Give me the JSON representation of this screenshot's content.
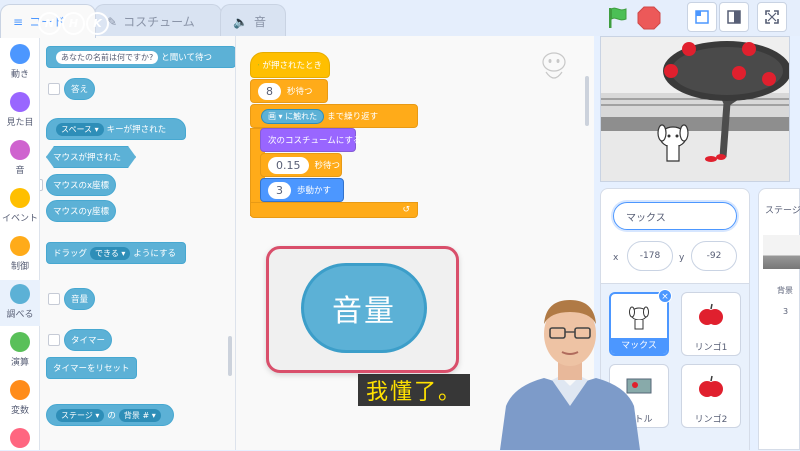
{
  "tabs": [
    {
      "label": "コード",
      "icon": "code-icon",
      "active": true
    },
    {
      "label": "コスチューム",
      "icon": "brush-icon",
      "active": false
    },
    {
      "label": "音",
      "icon": "speaker-icon",
      "active": false
    }
  ],
  "watermark": "NHK",
  "categories": [
    {
      "label": "動き",
      "color": "#4c97ff"
    },
    {
      "label": "見た目",
      "color": "#9966ff"
    },
    {
      "label": "音",
      "color": "#cf63cf"
    },
    {
      "label": "イベント",
      "color": "#ffbf00"
    },
    {
      "label": "制御",
      "color": "#ffab19"
    },
    {
      "label": "調べる",
      "color": "#5cb1d6",
      "active": true
    },
    {
      "label": "演算",
      "color": "#59c059"
    },
    {
      "label": "変数",
      "color": "#ff8c1a"
    },
    {
      "label": "",
      "color": "#ff6680"
    }
  ],
  "palette": {
    "ask_prefix": "あなたの名前は何ですか?",
    "ask_suffix": "と聞いて待つ",
    "answer": "答え",
    "key_pressed_key": "スペース ▾",
    "key_pressed_suffix": "キーが押された",
    "mouse_down": "マウスが押された",
    "mouse_x": "マウスのx座標",
    "mouse_y": "マウスのy座標",
    "drag_prefix": "ドラッグ",
    "drag_value": "できる ▾",
    "drag_suffix": "ようにする",
    "loudness": "音量",
    "timer": "タイマー",
    "reset_timer": "タイマーをリセット",
    "of_target": "ステージ ▾",
    "of_label": "の",
    "of_property": "背景 # ▾"
  },
  "script": {
    "hat": "が押されたとき",
    "wait_value": "8",
    "wait_label": "秒待つ",
    "until_sensor": "画 ▾",
    "until_touch": "に触れた",
    "until_label": "まで繰り返す",
    "next_costume": "次のコスチュームにする",
    "wait2_value": "0.15",
    "wait2_label": "秒待つ",
    "move_value": "3",
    "move_label": "歩動かす"
  },
  "callout": {
    "label": "音量"
  },
  "sprite_info": {
    "name": "マックス",
    "x_label": "x",
    "x_value": "-178",
    "y_label": "y",
    "y_value": "-92"
  },
  "sprites": [
    {
      "name": "マックス",
      "selected": true,
      "icon": "dog-icon"
    },
    {
      "name": "リンゴ1",
      "selected": false,
      "icon": "apple-icon"
    },
    {
      "name": "イトル",
      "selected": false,
      "icon": "title-icon"
    },
    {
      "name": "リンゴ2",
      "selected": false,
      "icon": "apple-icon"
    }
  ],
  "stage_pane": {
    "title": "ステージ",
    "backdrop_label": "背景",
    "backdrop_count": "3"
  },
  "subtitle": "我懂了。",
  "colors": {
    "accent": "#4c97ff",
    "sensing": "#5cb1d6",
    "callout_border": "#d94f6b",
    "subtitle_text": "#ffe100"
  }
}
